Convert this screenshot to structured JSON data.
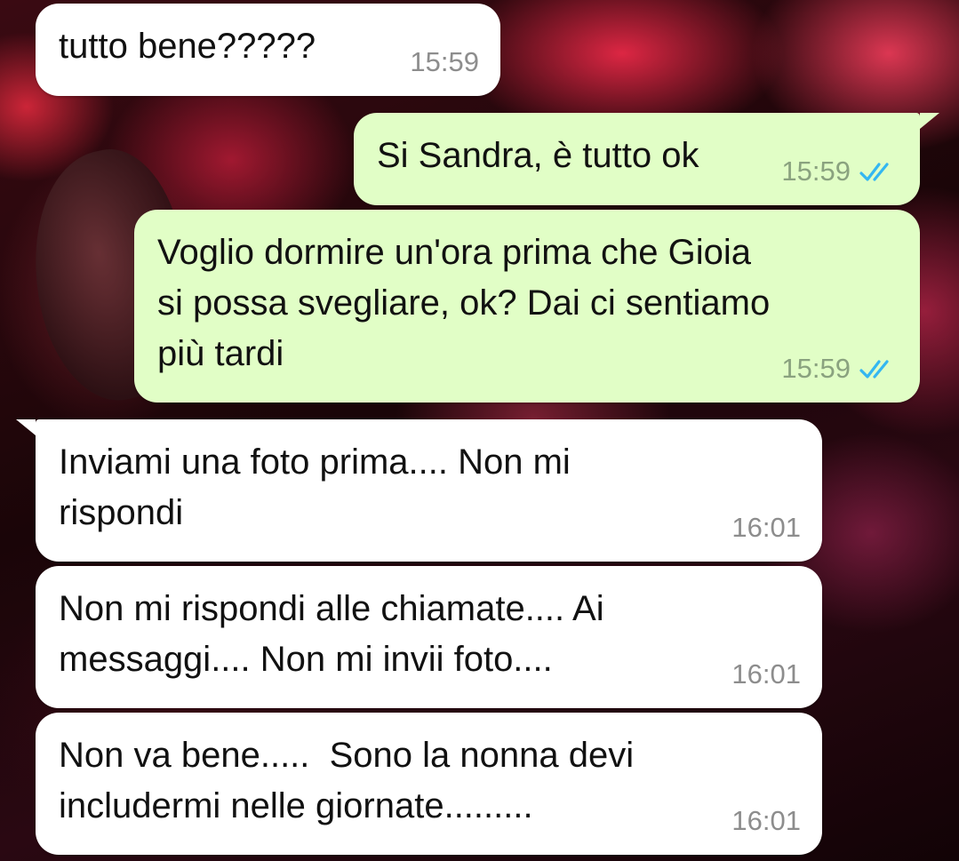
{
  "colors": {
    "incoming_bubble": "#ffffff",
    "outgoing_bubble": "#e1fec6",
    "timestamp_incoming": "#8d8d8d",
    "timestamp_outgoing": "#8aa27f",
    "read_ticks": "#34b7f1"
  },
  "wallpaper": {
    "description_icon": "red-flowers-wallpaper"
  },
  "messages": [
    {
      "direction": "incoming",
      "text": "tutto bene?????",
      "time": "15:59"
    },
    {
      "direction": "outgoing",
      "text": "Si Sandra, è tutto ok",
      "time": "15:59",
      "status_icon": "double-check-read-icon"
    },
    {
      "direction": "outgoing",
      "text": "Voglio dormire un'ora prima che Gioia\nsi possa svegliare, ok? Dai ci sentiamo\npiù tardi",
      "time": "15:59",
      "status_icon": "double-check-read-icon"
    },
    {
      "direction": "incoming",
      "text": "Inviami una foto prima.... Non mi\nrispondi",
      "time": "16:01"
    },
    {
      "direction": "incoming",
      "text": "Non mi rispondi alle chiamate.... Ai\nmessaggi.... Non mi invii foto....",
      "time": "16:01"
    },
    {
      "direction": "incoming",
      "text": "Non va bene.....  Sono la nonna devi\nincludermi nelle giornate.........",
      "time": "16:01"
    }
  ]
}
